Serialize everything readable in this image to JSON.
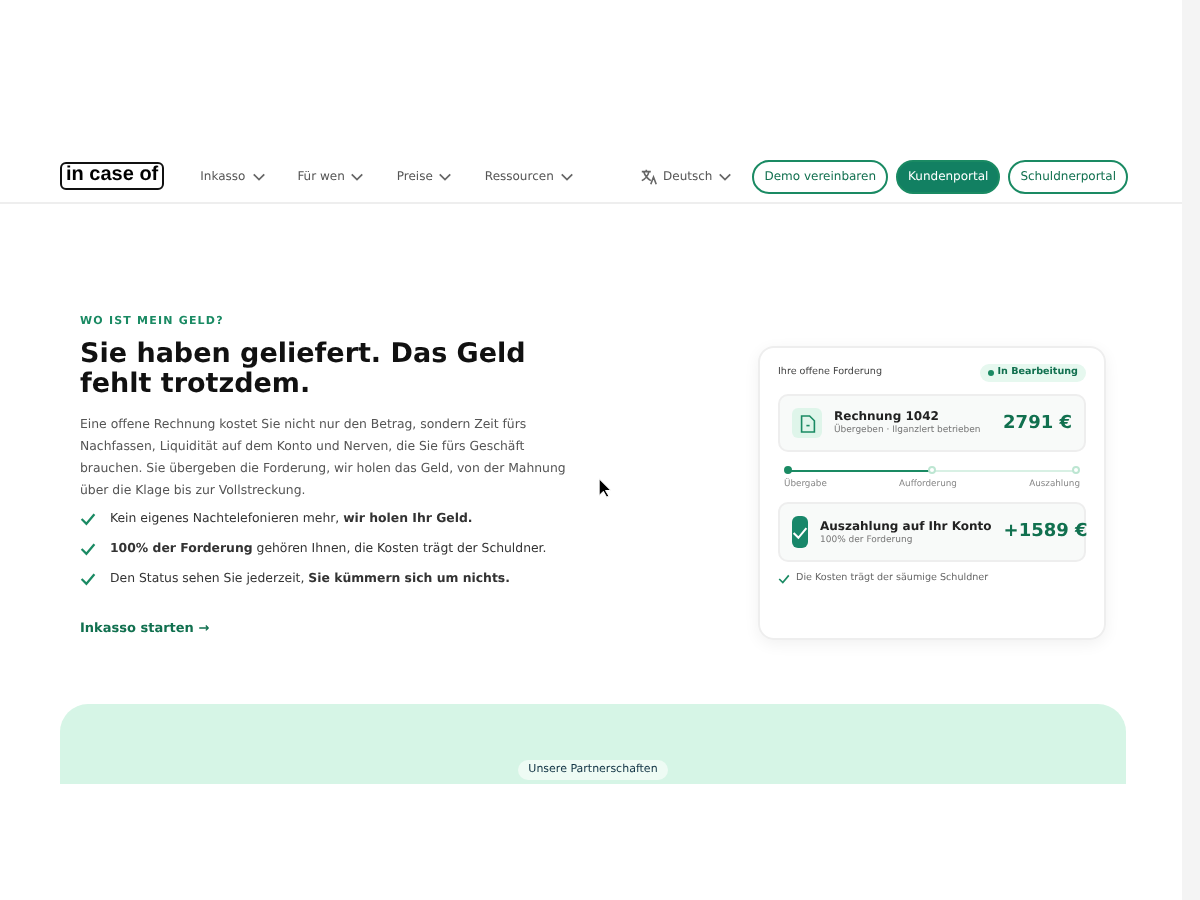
{
  "nav": {
    "logo": "in case of",
    "menu": [
      {
        "label": "Inkasso"
      },
      {
        "label": "Für wen"
      },
      {
        "label": "Preise"
      },
      {
        "label": "Ressourcen"
      }
    ],
    "language": "Deutsch",
    "buttons": [
      {
        "label": "Demo vereinbaren",
        "kind": "outline"
      },
      {
        "label": "Kundenportal",
        "kind": "filled"
      },
      {
        "label": "Schuldnerportal",
        "kind": "outline"
      }
    ]
  },
  "hero": {
    "eyebrow": "WO IST MEIN GELD?",
    "title": "Sie haben geliefert. Das Geld fehlt trotzdem.",
    "text": "Eine offene Rechnung kostet Sie nicht nur den Betrag, sondern Zeit fürs Nachfassen, Liquidität auf dem Konto und Nerven, die Sie fürs Geschäft brauchen. Sie übergeben die Forderung, wir holen das Geld, von der Mahnung über die Klage bis zur Vollstreckung.",
    "bullets": [
      "Kein eigenes Nachtelefonieren mehr, **wir holen Ihr Geld.**",
      "**100% der Forderung** gehören Ihnen, die Kosten trägt der Schuldner.",
      "Den Status sehen Sie jederzeit, **Sie kümmern sich um nichts.**"
    ],
    "link": "Inkasso starten",
    "link_arrow": "→"
  },
  "card": {
    "title": "Ihre offene Forderung",
    "status": "In Bearbeitung",
    "invoice": {
      "name": "Rechnung 1042",
      "sub": "Übergeben · Ilganzlert betrieben",
      "amount": "2791 €"
    },
    "progress": {
      "level": 0.5,
      "steps": [
        {
          "label": "Übergabe",
          "done": true
        },
        {
          "label": "Aufforderung",
          "done": false
        },
        {
          "label": "Auszahlung",
          "done": false
        }
      ]
    },
    "payout": {
      "name": "Auszahlung auf Ihr Konto",
      "sub": "100% der Forderung",
      "amount": "+1589 €"
    },
    "note": "Die Kosten trägt der säumige Schuldner"
  },
  "partners": {
    "badge": "Unsere Partnerschaften"
  }
}
